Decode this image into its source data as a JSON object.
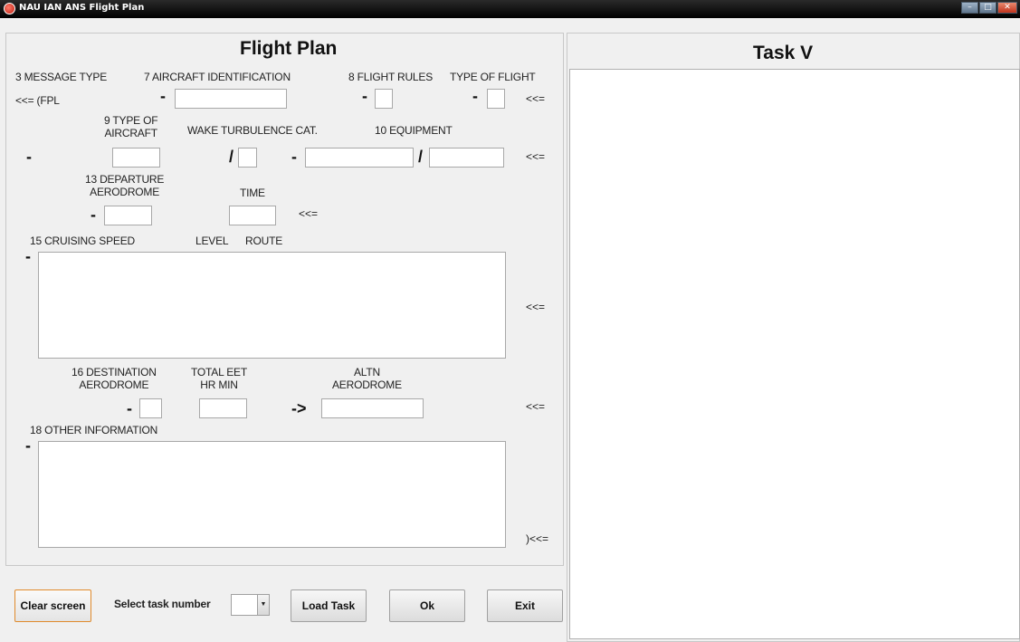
{
  "window": {
    "title": "NAU IAN ANS Flight Plan",
    "icon": "app-circle-icon"
  },
  "form": {
    "title": "Flight Plan",
    "f3_label": "3 MESSAGE TYPE",
    "f7_label": "7 AIRCRAFT IDENTIFICATION",
    "f8_label": "8  FLIGHT RULES",
    "tof_label": "TYPE OF FLIGHT",
    "fpl_prefix": "<<= (FPL",
    "f9_label": "9 TYPE OF\nAIRCRAFT",
    "wtc_label": "WAKE TURBULENCE CAT.",
    "f10_label": "10 EQUIPMENT",
    "f13_label": "13 DEPARTURE\nAERODROME",
    "time_label": "TIME",
    "f15_label": "15 CRUISING SPEED",
    "level_label": "LEVEL",
    "route_label": "ROUTE",
    "f16_label": "16 DESTINATION\nAERODROME",
    "eet_label": "TOTAL EET\nHR MIN",
    "altn_label": "ALTN\nAERODROME",
    "f18_label": "18 OTHER INFORMATION",
    "dash": "-",
    "slash": "/",
    "row_end": "<<=",
    "altn_arrow": "->",
    "last_end": ")<<=",
    "values": {
      "aircraft_id": "",
      "flight_rules": "",
      "type_of_flight": "",
      "aircraft_type": "",
      "wake_cat": "",
      "equipment_a": "",
      "equipment_b": "",
      "departure": "",
      "time": "",
      "route": "",
      "destination": "",
      "total_eet": "",
      "altn": "",
      "other_info": ""
    }
  },
  "task": {
    "title": "Task V",
    "content": ""
  },
  "controls": {
    "clear_label": "Clear screen",
    "select_label": "Select task number",
    "select_value": "",
    "load_label": "Load Task",
    "ok_label": "Ok",
    "exit_label": "Exit"
  },
  "colors": {
    "focus_border": "#e08a2b",
    "titlebar": "#000000"
  }
}
